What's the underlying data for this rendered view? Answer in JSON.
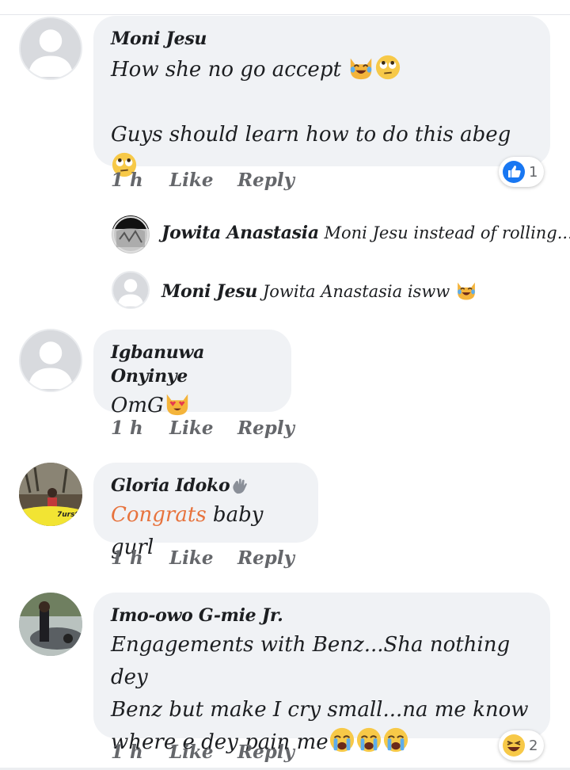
{
  "comments": [
    {
      "name": "Moni Jesu",
      "line1": "How she no go accept ",
      "line2": "Guys should learn how to do this abeg ",
      "time": "1 h",
      "like": "Like",
      "reply": "Reply",
      "reaction_count": "1",
      "reaction_icon": "like-icon"
    },
    {
      "name": "Igbanuwa Onyinye",
      "text": "OmG",
      "time": "1 h",
      "like": "Like",
      "reply": "Reply"
    },
    {
      "name": "Gloria Idoko",
      "highlight": "Congrats",
      "text": " baby gurl",
      "time": "1 h",
      "like": "Like",
      "reply": "Reply"
    },
    {
      "name": "Imo-owo G-mie Jr.",
      "line1": "Engagements with Benz...Sha nothing dey",
      "line2": "Benz but make I cry small...na me know",
      "line3": "where e dey pain me",
      "time": "1 h",
      "like": "Like",
      "reply": "Reply",
      "reaction_count": "2",
      "reaction_icon": "laugh-icon"
    }
  ],
  "replies": [
    {
      "name": "Jowita Anastasia",
      "text": " Moni Jesu instead of rolling..."
    },
    {
      "name": "Moni Jesu",
      "text": " Jowita Anastasia isww "
    }
  ],
  "colors": {
    "bubble": "#f0f2f5",
    "meta": "#65676b",
    "link": "#e7733d",
    "like_blue": "#1877f2"
  }
}
